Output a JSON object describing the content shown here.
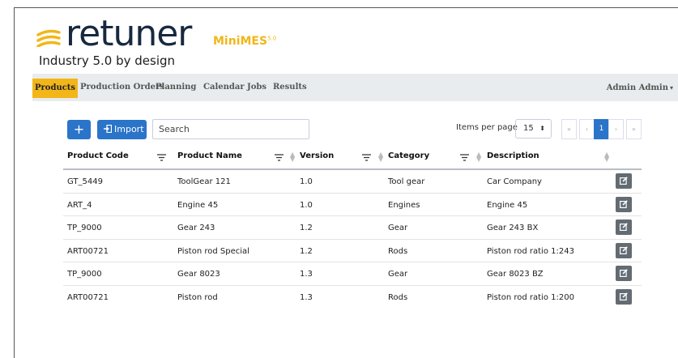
{
  "brand": {
    "name": "retuner",
    "product": "MiniMES",
    "product_version": "5.0",
    "tagline": "Industry 5.0 by design",
    "accent_color": "#f2b619",
    "primary_color": "#2a74c9"
  },
  "nav": {
    "items": [
      {
        "label": "Products",
        "active": true
      },
      {
        "label": "Production Orders"
      },
      {
        "label": "Planning"
      },
      {
        "label": "Calendar"
      },
      {
        "label": "Jobs"
      },
      {
        "label": "Results"
      }
    ],
    "user": "Admin Admin"
  },
  "toolbar": {
    "add_label": "+",
    "import_label": "Import",
    "search_placeholder": "Search",
    "items_per_page_label": "Items per page",
    "items_per_page_value": "15",
    "pager": {
      "first": "«",
      "prev": "‹",
      "current": "1",
      "next": "›",
      "last": "»"
    }
  },
  "table": {
    "columns": [
      "Product Code",
      "Product Name",
      "Version",
      "Category",
      "Description"
    ],
    "rows": [
      {
        "code": "GT_5449",
        "name": "ToolGear 121",
        "version": "1.0",
        "category": "Tool gear",
        "description": "Car Company"
      },
      {
        "code": "ART_4",
        "name": "Engine 45",
        "version": "1.0",
        "category": "Engines",
        "description": "Engine 45"
      },
      {
        "code": "TP_9000",
        "name": "Gear 243",
        "version": "1.2",
        "category": "Gear",
        "description": "Gear 243 BX"
      },
      {
        "code": "ART00721",
        "name": "Piston rod Special",
        "version": "1.2",
        "category": "Rods",
        "description": "Piston rod ratio 1:243"
      },
      {
        "code": "TP_9000",
        "name": "Gear 8023",
        "version": "1.3",
        "category": "Gear",
        "description": "Gear 8023 BZ"
      },
      {
        "code": "ART00721",
        "name": "Piston rod",
        "version": "1.3",
        "category": "Rods",
        "description": "Piston rod ratio 1:200"
      }
    ]
  }
}
